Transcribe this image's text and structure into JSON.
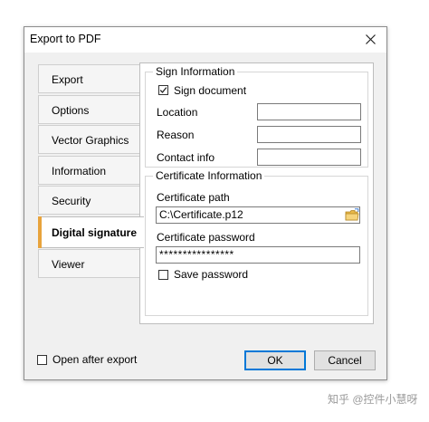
{
  "window": {
    "title": "Export to PDF"
  },
  "tabs": [
    {
      "label": "Export"
    },
    {
      "label": "Options"
    },
    {
      "label": "Vector Graphics"
    },
    {
      "label": "Information"
    },
    {
      "label": "Security"
    },
    {
      "label": "Digital signature",
      "active": true
    },
    {
      "label": "Viewer"
    }
  ],
  "sign_info": {
    "group_label": "Sign Information",
    "sign_document_label": "Sign document",
    "sign_document_checked": true,
    "location_label": "Location",
    "location_value": "",
    "reason_label": "Reason",
    "reason_value": "",
    "contact_label": "Contact info",
    "contact_value": ""
  },
  "certificate": {
    "group_label": "Certificate Information",
    "path_label": "Certificate path",
    "path_value": "C:\\Certificate.p12",
    "password_label": "Certificate password",
    "password_value": "****************",
    "save_password_label": "Save password",
    "save_password_checked": false
  },
  "footer": {
    "open_after_export_label": "Open after export",
    "open_after_export_checked": false,
    "ok_label": "OK",
    "cancel_label": "Cancel"
  },
  "watermark": "知乎 @控件小慧呀",
  "colors": {
    "accent": "#e8a33c",
    "default_button_border": "#0078d7"
  }
}
